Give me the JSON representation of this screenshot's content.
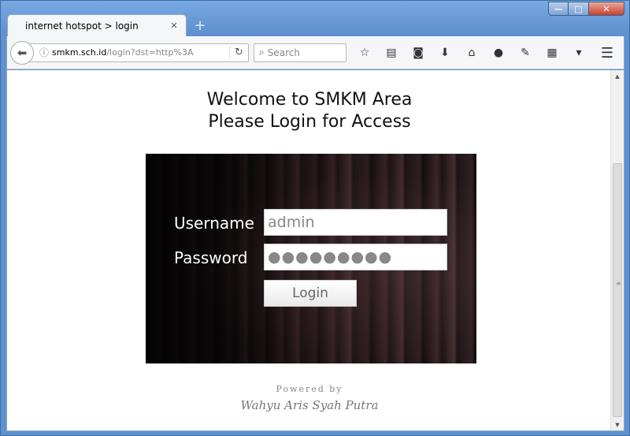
{
  "browser": {
    "tab_title": "internet hotspot > login",
    "tab_close_glyph": "✕",
    "newtab_glyph": "+",
    "url_host": "smkm.sch.id",
    "url_rest": "/login?dst=http%3A",
    "search_placeholder": "Search",
    "window_controls": {
      "min": "—",
      "max": "□",
      "close": "✕"
    },
    "icons": [
      "bookmark-star-icon",
      "reading-list-icon",
      "pocket-icon",
      "download-icon",
      "home-icon",
      "chat-icon",
      "screenshot-icon",
      "library-icon",
      "overflow-chevron-icon"
    ]
  },
  "page": {
    "welcome_line1": "Welcome to SMKM Area",
    "welcome_line2": "Please Login for Access",
    "username_label": "Username",
    "password_label": "Password",
    "username_value": "admin",
    "password_value": "●●●●●●●●●",
    "login_button": "Login",
    "powered_by": "Powered by",
    "author": "Wahyu Aris Syah Putra"
  }
}
